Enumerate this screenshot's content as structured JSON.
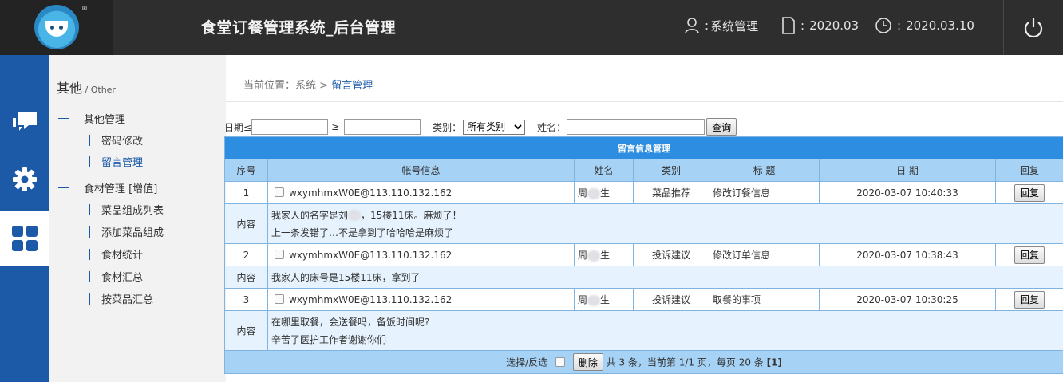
{
  "header": {
    "logo_mark": "®",
    "title": "食堂订餐管理系统_后台管理",
    "user_label": "系统管理",
    "month_label": "2020.03",
    "date_label": "2020.03.10",
    "colon": ":"
  },
  "icons": {
    "topbar": [
      "user-icon",
      "document-icon",
      "clock-icon",
      "power-icon"
    ],
    "side": [
      "chat-icon",
      "gear-icon",
      "grid-icon"
    ]
  },
  "colors": {
    "primary": "#1c5aa8",
    "header_bg": "#2e2e2e",
    "table_caption": "#2d8de0",
    "table_header": "#a6d2f5"
  },
  "sidebar": {
    "heading": "其他",
    "heading_sep": " / ",
    "heading_en": "Other",
    "groups": [
      {
        "label": "其他管理",
        "items": [
          "密码修改",
          "留言管理"
        ]
      },
      {
        "label": "食材管理 [增值]",
        "items": [
          "菜品组成列表",
          "添加菜品组成",
          "食材统计",
          "食材汇总",
          "按菜品汇总"
        ]
      }
    ]
  },
  "breadcrumb": {
    "prefix": "当前位置：系统",
    "sep": " > ",
    "current": "留言管理"
  },
  "filters": {
    "date_label": "日期≤",
    "ge_label": "≥",
    "category_label": "类别：",
    "category_value": "所有类别",
    "name_label": "姓名：",
    "query_button": "查询"
  },
  "table": {
    "caption": "留言信息管理",
    "columns": [
      "序号",
      "帐号信息",
      "姓名",
      "类别",
      "标 题",
      "日 期",
      "回复"
    ],
    "content_label": "内容",
    "reply_button": "回复",
    "rows": [
      {
        "no": "1",
        "account": "wxymhmxW0E@113.110.132.162",
        "name_a": "周",
        "name_b": "生",
        "category": "菜品推荐",
        "title": "修改订餐信息",
        "date": "2020-03-07 10:40:33",
        "content": [
          "我家人的名字是刘",
          "，15楼11床。麻烦了！",
          "上一条发错了…不是拿到了哈哈哈是麻烦了"
        ]
      },
      {
        "no": "2",
        "account": "wxymhmxW0E@113.110.132.162",
        "name_a": "周",
        "name_b": "生",
        "category": "投诉建议",
        "title": "修改订单信息",
        "date": "2020-03-07 10:38:43",
        "content": [
          "我家人的床号是15楼11床，拿到了"
        ]
      },
      {
        "no": "3",
        "account": "wxymhmxW0E@113.110.132.162",
        "name_a": "周",
        "name_b": "生",
        "category": "投诉建议",
        "title": "取餐的事项",
        "date": "2020-03-07 10:30:25",
        "content": [
          "在哪里取餐，会送餐吗，备饭时间呢?",
          "辛苦了医护工作者谢谢你们"
        ]
      }
    ],
    "footer": {
      "select_label": "选择/反选",
      "delete_button": "删除",
      "summary": "共 3 条，当前第 1/1 页，每页 20 条",
      "pages": "[1]"
    }
  }
}
